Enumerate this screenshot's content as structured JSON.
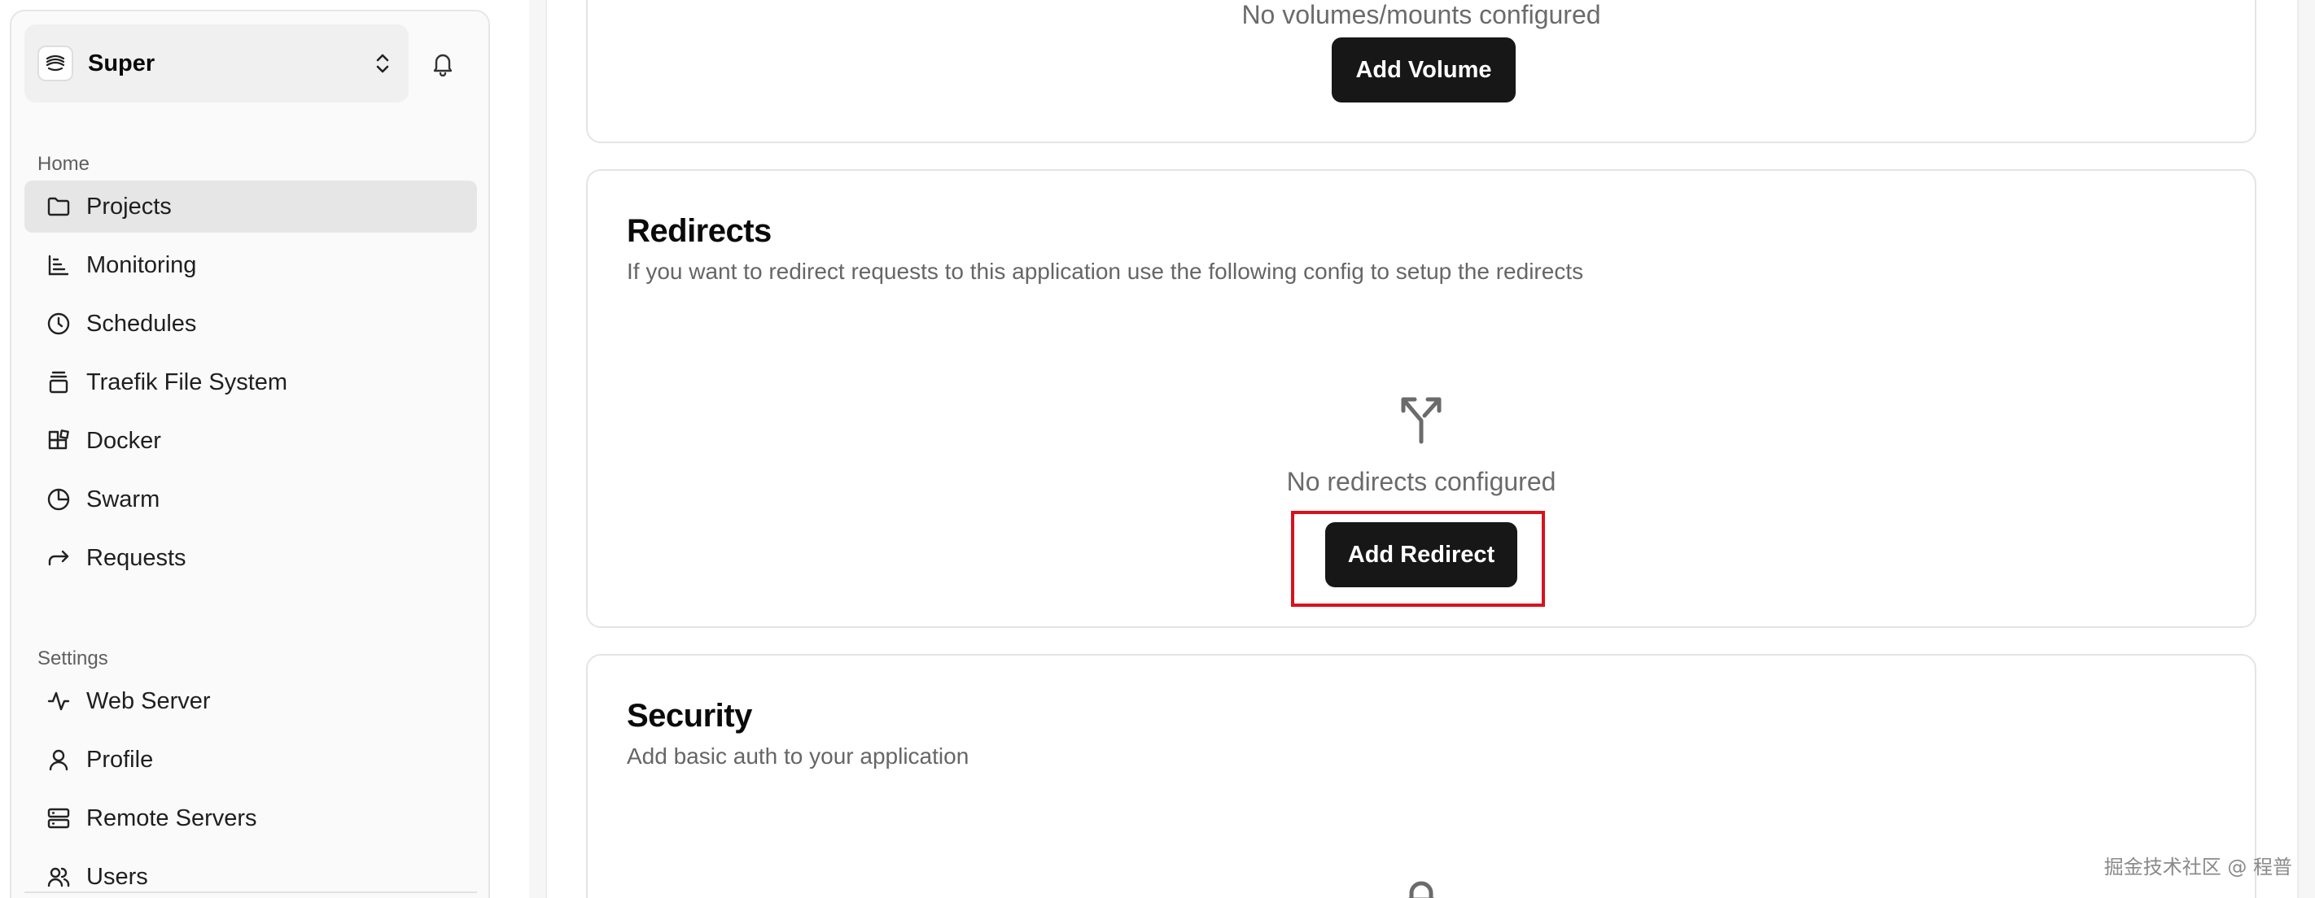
{
  "sidebar": {
    "team_name": "Super",
    "groups": [
      {
        "label": "Home",
        "items": [
          {
            "label": "Projects",
            "icon": "folder-icon",
            "active": true
          },
          {
            "label": "Monitoring",
            "icon": "chart-icon"
          },
          {
            "label": "Schedules",
            "icon": "clock-icon"
          },
          {
            "label": "Traefik File System",
            "icon": "stack-icon"
          },
          {
            "label": "Docker",
            "icon": "blocks-icon"
          },
          {
            "label": "Swarm",
            "icon": "pie-chart-icon"
          },
          {
            "label": "Requests",
            "icon": "forward-arrow-icon"
          }
        ]
      },
      {
        "label": "Settings",
        "items": [
          {
            "label": "Web Server",
            "icon": "activity-icon"
          },
          {
            "label": "Profile",
            "icon": "user-icon"
          },
          {
            "label": "Remote Servers",
            "icon": "server-icon"
          },
          {
            "label": "Users",
            "icon": "users-icon"
          }
        ]
      }
    ]
  },
  "volumes": {
    "empty_text": "No volumes/mounts configured",
    "button_label": "Add Volume"
  },
  "redirects": {
    "title": "Redirects",
    "description": "If you want to redirect requests to this application use the following config to setup the redirects",
    "empty_text": "No redirects configured",
    "button_label": "Add Redirect",
    "icon": "split-arrows-icon"
  },
  "security": {
    "title": "Security",
    "description": "Add basic auth to your application",
    "icon": "lock-icon"
  },
  "watermark": "掘金技术社区 @ 程普",
  "colors": {
    "button_bg": "#171717",
    "highlight": "#d9111c",
    "active_item": "#e6e6e6"
  }
}
